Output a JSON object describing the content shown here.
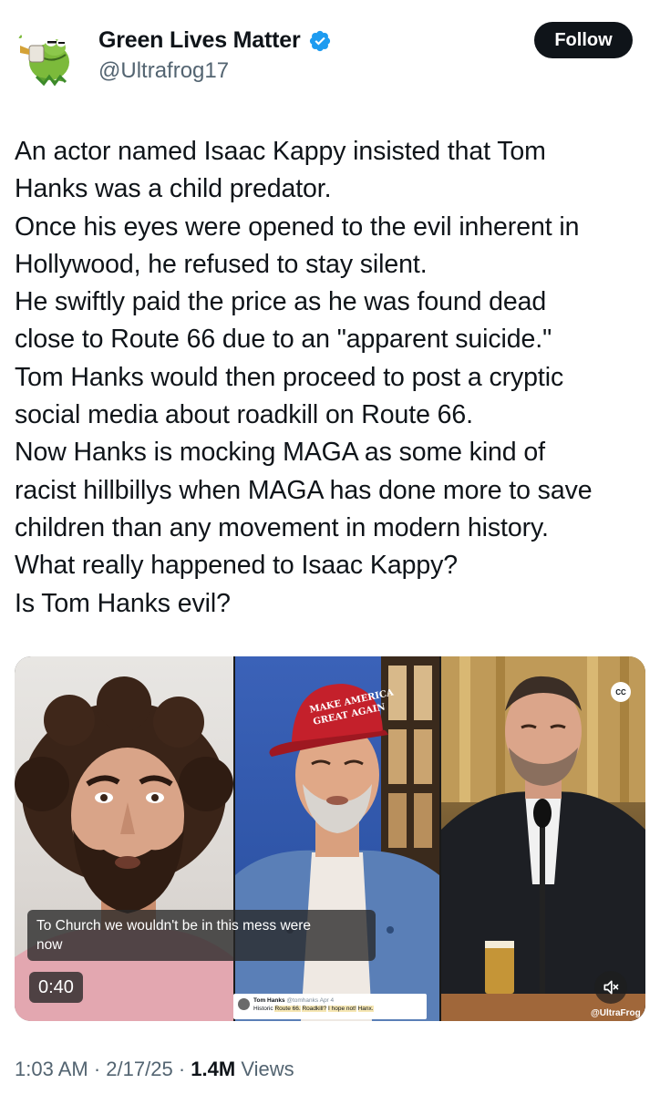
{
  "author": {
    "display_name": "Green Lives Matter",
    "handle": "@Ultrafrog17",
    "avatar_icon": "kermit-frog-avatar",
    "verified_icon": "verified-badge-icon",
    "verified_color": "#1d9bf0"
  },
  "follow_label": "Follow",
  "tweet_lines": [
    "An actor named Isaac Kappy insisted that Tom",
    "Hanks was a child predator.",
    "Once his eyes were opened to the evil inherent in",
    "Hollywood, he refused to stay silent.",
    "He swiftly paid the price as he was found dead",
    "close to Route 66 due to an \"apparent suicide.\"",
    "Tom Hanks would then proceed to post a cryptic",
    "social media about roadkill on Route 66.",
    "Now Hanks is mocking MAGA as some kind of",
    "racist hillbillys when MAGA has done more to save",
    "children than any movement in modern history.",
    "What really happened to Isaac Kappy?",
    "Is Tom Hanks evil?"
  ],
  "video": {
    "caption_line1": "To Church we wouldn't be in this mess were",
    "caption_line2": "now",
    "duration": "0:40",
    "cc_label": "CC",
    "watermark": "@UltraFrog",
    "hat_line1": "MAKE AMERICA",
    "hat_line2": "GREAT AGAIN",
    "embedded_post": {
      "name": "Tom Hanks",
      "handle": "@tomhanks",
      "date": "Apr 4",
      "text_plain": "Historic",
      "text_highlight1": "Route 66.",
      "text_highlight2": "Roadkill?",
      "text_highlight3": "I hope not!",
      "text_highlight4": "Hanx."
    }
  },
  "meta": {
    "time": "1:03 AM",
    "separator": "·",
    "date": "2/17/25",
    "views_count": "1.4M",
    "views_label": "Views"
  }
}
